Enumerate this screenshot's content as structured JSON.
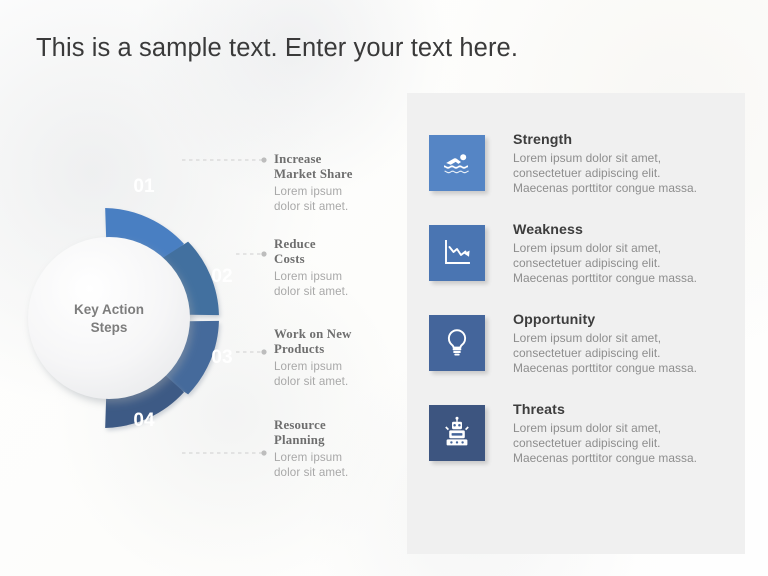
{
  "slide": {
    "title": "This is a sample text. Enter your text here.",
    "background_color": "#fdfdfc",
    "panel_background_color": "#f0f0f0"
  },
  "donut": {
    "hub_line1": "Key Action",
    "hub_line2": "Steps",
    "segments": [
      {
        "number": "01",
        "color": "#4a7fc2"
      },
      {
        "number": "02",
        "color": "#43709f"
      },
      {
        "number": "03",
        "color": "#456b9b"
      },
      {
        "number": "04",
        "color": "#3d5a85"
      }
    ]
  },
  "steps": [
    {
      "title_line1": "Increase",
      "title_line2": "Market Share",
      "desc_line1": "Lorem ipsum",
      "desc_line2": "dolor sit amet."
    },
    {
      "title_line1": "Reduce",
      "title_line2": "Costs",
      "desc_line1": "Lorem ipsum",
      "desc_line2": "dolor sit amet."
    },
    {
      "title_line1": "Work on New",
      "title_line2": "Products",
      "desc_line1": "Lorem ipsum",
      "desc_line2": "dolor sit amet."
    },
    {
      "title_line1": "Resource",
      "title_line2": "Planning",
      "desc_line1": "Lorem ipsum",
      "desc_line2": "dolor sit amet."
    }
  ],
  "swot": [
    {
      "title": "Strength",
      "icon": "swimmer-icon",
      "color": "#5585c5",
      "desc_line1": "Lorem ipsum dolor sit amet,",
      "desc_line2": "consectetuer adipiscing elit.",
      "desc_line3": "Maecenas porttitor congue massa."
    },
    {
      "title": "Weakness",
      "icon": "declining-chart-icon",
      "color": "#4a75b2",
      "desc_line1": "Lorem ipsum dolor sit amet,",
      "desc_line2": "consectetuer adipiscing elit.",
      "desc_line3": "Maecenas porttitor congue massa."
    },
    {
      "title": "Opportunity",
      "icon": "lightbulb-icon",
      "color": "#44659b",
      "desc_line1": "Lorem ipsum dolor sit amet,",
      "desc_line2": "consectetuer adipiscing elit.",
      "desc_line3": "Maecenas porttitor congue massa."
    },
    {
      "title": "Threats",
      "icon": "robot-icon",
      "color": "#3d5580",
      "desc_line1": "Lorem ipsum dolor sit amet,",
      "desc_line2": "consectetuer adipiscing elit.",
      "desc_line3": "Maecenas porttitor congue massa."
    }
  ]
}
